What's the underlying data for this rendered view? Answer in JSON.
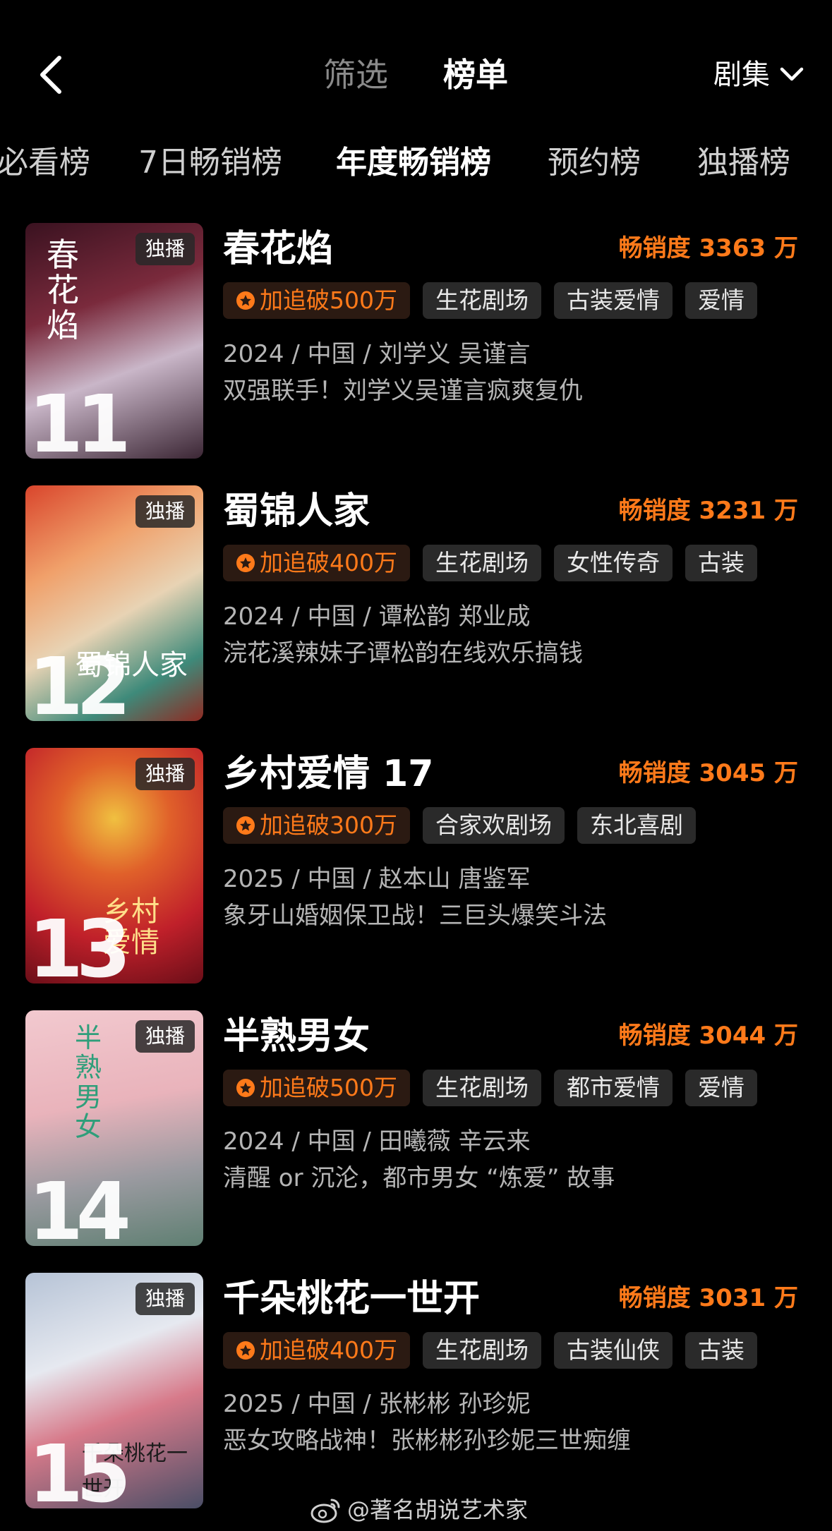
{
  "header": {
    "tabs": [
      {
        "label": "筛选",
        "active": false
      },
      {
        "label": "榜单",
        "active": true
      }
    ],
    "category_select": "剧集"
  },
  "subtabs": [
    {
      "label": "必看榜",
      "active": false
    },
    {
      "label": "7日畅销榜",
      "active": false
    },
    {
      "label": "年度畅销榜",
      "active": true
    },
    {
      "label": "预约榜",
      "active": false
    },
    {
      "label": "独播榜",
      "active": false
    }
  ],
  "items": [
    {
      "rank": "11",
      "badge": "独播",
      "title": "春花焰",
      "sales": "畅销度 3363 万",
      "hot_tag": "加追破500万",
      "tags": [
        "生花剧场",
        "古装爱情",
        "爱情"
      ],
      "meta": "2024 / 中国 / 刘学义 吴谨言",
      "desc": "双强联手！刘学义吴谨言疯爽复仇",
      "poster_text": "春花焰"
    },
    {
      "rank": "12",
      "badge": "独播",
      "title": "蜀锦人家",
      "sales": "畅销度 3231 万",
      "hot_tag": "加追破400万",
      "tags": [
        "生花剧场",
        "女性传奇",
        "古装"
      ],
      "meta": "2024 / 中国 / 谭松韵 郑业成",
      "desc": "浣花溪辣妹子谭松韵在线欢乐搞钱",
      "poster_text": "蜀锦人家"
    },
    {
      "rank": "13",
      "badge": "独播",
      "title": "乡村爱情 17",
      "sales": "畅销度 3045 万",
      "hot_tag": "加追破300万",
      "tags": [
        "合家欢剧场",
        "东北喜剧"
      ],
      "meta": "2025 / 中国 / 赵本山 唐鉴军",
      "desc": "象牙山婚姻保卫战！三巨头爆笑斗法",
      "poster_text": "乡村爱情"
    },
    {
      "rank": "14",
      "badge": "独播",
      "title": "半熟男女",
      "sales": "畅销度 3044 万",
      "hot_tag": "加追破500万",
      "tags": [
        "生花剧场",
        "都市爱情",
        "爱情"
      ],
      "meta": "2024 / 中国 / 田曦薇 辛云来",
      "desc": "清醒 or 沉沦，都市男女 “炼爱” 故事",
      "poster_text": "半熟男女"
    },
    {
      "rank": "15",
      "badge": "独播",
      "title": "千朵桃花一世开",
      "sales": "畅销度 3031 万",
      "hot_tag": "加追破400万",
      "tags": [
        "生花剧场",
        "古装仙侠",
        "古装"
      ],
      "meta": "2025 / 中国 / 张彬彬 孙珍妮",
      "desc": "恶女攻略战神！张彬彬孙珍妮三世痴缠",
      "poster_text": "千朵桃花一世开"
    }
  ],
  "watermark": "@著名胡说艺术家",
  "colors": {
    "accent": "#ff7a1a",
    "tag_bg": "#2a2a2a",
    "background": "#000000"
  }
}
